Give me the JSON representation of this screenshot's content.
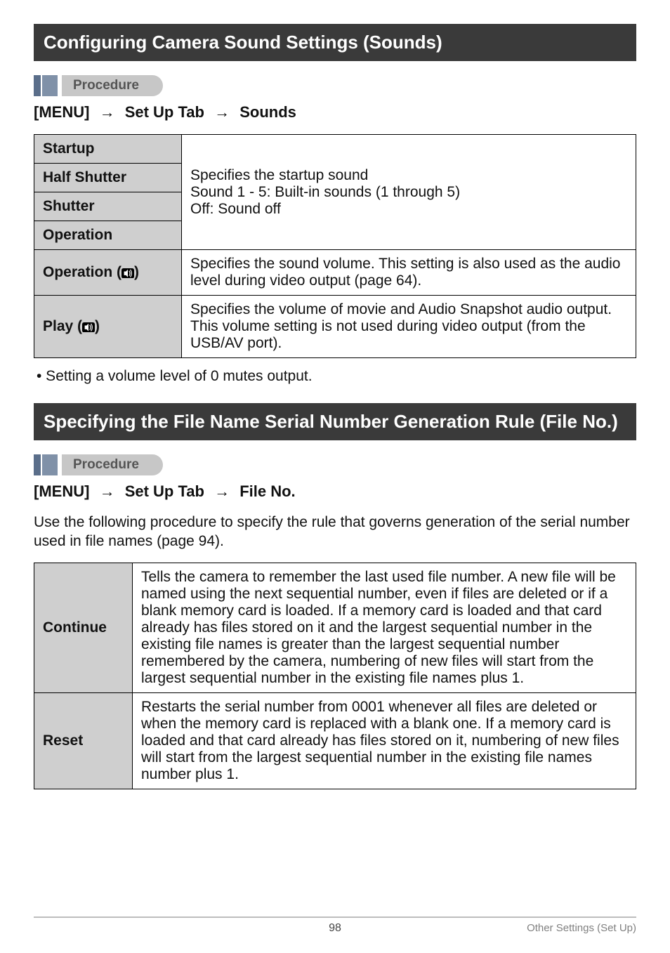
{
  "heading1": "Configuring Camera Sound Settings (Sounds)",
  "procedure_label": "Procedure",
  "menu1": {
    "pre": "[MENU]",
    "mid": "Set Up Tab",
    "post": "Sounds"
  },
  "table1": {
    "rows": [
      {
        "key": "Startup"
      },
      {
        "key": "Half Shutter"
      },
      {
        "key": "Shutter"
      },
      {
        "key": "Operation"
      }
    ],
    "merged_value_lines": [
      "Specifies the startup sound",
      "Sound 1 - 5: Built-in sounds (1 through 5)",
      "Off: Sound off"
    ],
    "op_vol": {
      "key": "Operation (",
      "key_suffix": ")",
      "value": "Specifies the sound volume. This setting is also used as the audio level during video output (page 64)."
    },
    "play_vol": {
      "key": "Play (",
      "key_suffix": ")",
      "value": "Specifies the volume of movie and Audio Snapshot audio output. This volume setting is not used during video output (from the USB/AV port)."
    }
  },
  "bullet1": "• Setting a volume level of 0 mutes output.",
  "heading2": "Specifying the File Name Serial Number Generation Rule (File No.)",
  "menu2": {
    "pre": "[MENU]",
    "mid": "Set Up Tab",
    "post": "File No."
  },
  "para2": "Use the following procedure to specify the rule that governs generation of the serial number used in file names (page 94).",
  "table2": {
    "continue": {
      "key": "Continue",
      "value": "Tells the camera to remember the last used file number. A new file will be named using the next sequential number, even if files are deleted or if a blank memory card is loaded. If a memory card is loaded and that card already has files stored on it and the largest sequential number in the existing file names is greater than the largest sequential number remembered by the camera, numbering of new files will start from the largest sequential number in the existing file names plus 1."
    },
    "reset": {
      "key": "Reset",
      "value": "Restarts the serial number from 0001 whenever all files are deleted or when the memory card is replaced with a blank one. If a memory card is loaded and that card already has files stored on it, numbering of new files will start from the largest sequential number in the existing file names number plus 1."
    }
  },
  "footer": {
    "page": "98",
    "section": "Other Settings (Set Up)"
  }
}
